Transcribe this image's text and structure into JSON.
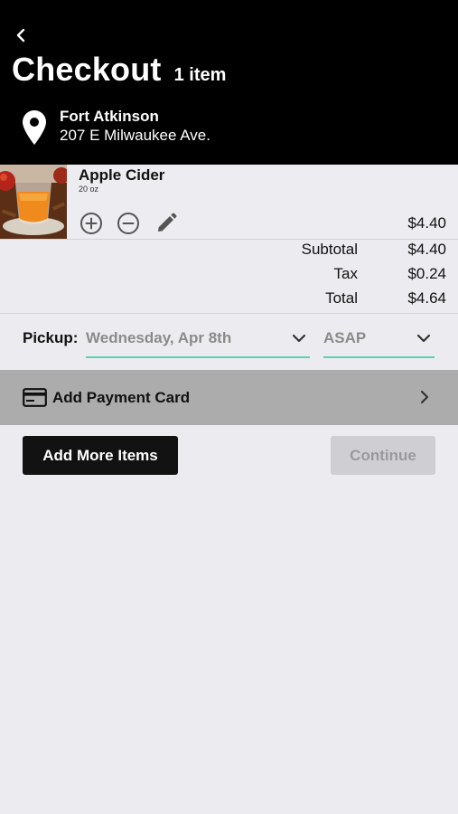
{
  "header": {
    "title": "Checkout",
    "item_count": "1 item",
    "location_name": "Fort Atkinson",
    "location_address": "207 E Milwaukee Ave."
  },
  "cart": {
    "items": [
      {
        "name": "Apple Cider",
        "size": "20 oz",
        "price": "$4.40",
        "image": "apple-cider-photo"
      }
    ]
  },
  "totals": {
    "subtotal_label": "Subtotal",
    "subtotal": "$4.40",
    "tax_label": "Tax",
    "tax": "$0.24",
    "total_label": "Total",
    "total": "$4.64"
  },
  "pickup": {
    "label": "Pickup:",
    "date": "Wednesday, Apr 8th",
    "time": "ASAP",
    "accent": "#5fd0b4"
  },
  "payment": {
    "label": "Add Payment Card",
    "icon": "credit-card-icon"
  },
  "actions": {
    "add_more": "Add More Items",
    "continue": "Continue"
  },
  "colors": {
    "header_bg": "#000000",
    "page_bg": "#ebebf0",
    "payment_bg": "#acacac",
    "primary_button": "#121212",
    "disabled_button": "#cfcfd3"
  }
}
